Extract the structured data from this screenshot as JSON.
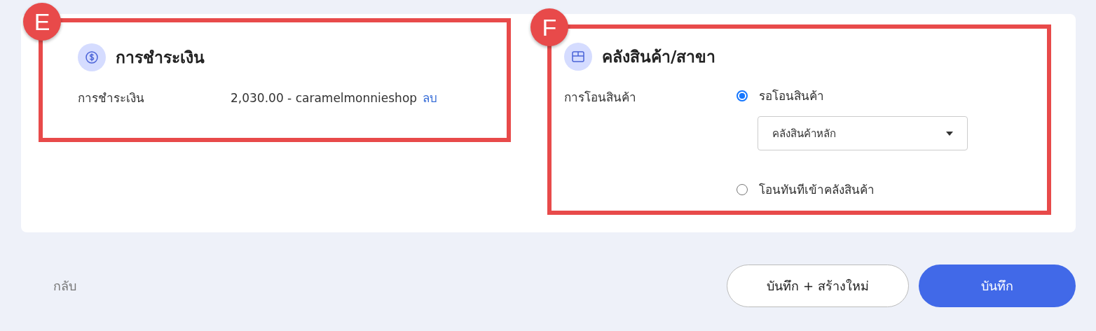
{
  "payment": {
    "badge": "E",
    "title": "การชำระเงิน",
    "row": {
      "label": "การชำระเงิน",
      "value": "2,030.00 - caramelmonnieshop",
      "action": "ลบ"
    }
  },
  "warehouse": {
    "badge": "F",
    "title": "คลังสินค้า/สาขา",
    "label": "การโอนสินค้า",
    "options": [
      {
        "label": "รอโอนสินค้า",
        "selected": true,
        "select": {
          "value": "คลังสินค้าหลัก"
        }
      },
      {
        "label": "โอนทันทีเข้าคลังสินค้า",
        "selected": false
      }
    ]
  },
  "footer": {
    "back": "กลับ",
    "buttons": [
      {
        "label": "บันทึก + สร้างใหม่",
        "kind": "secondary"
      },
      {
        "label": "บันทึก",
        "kind": "primary"
      }
    ]
  }
}
